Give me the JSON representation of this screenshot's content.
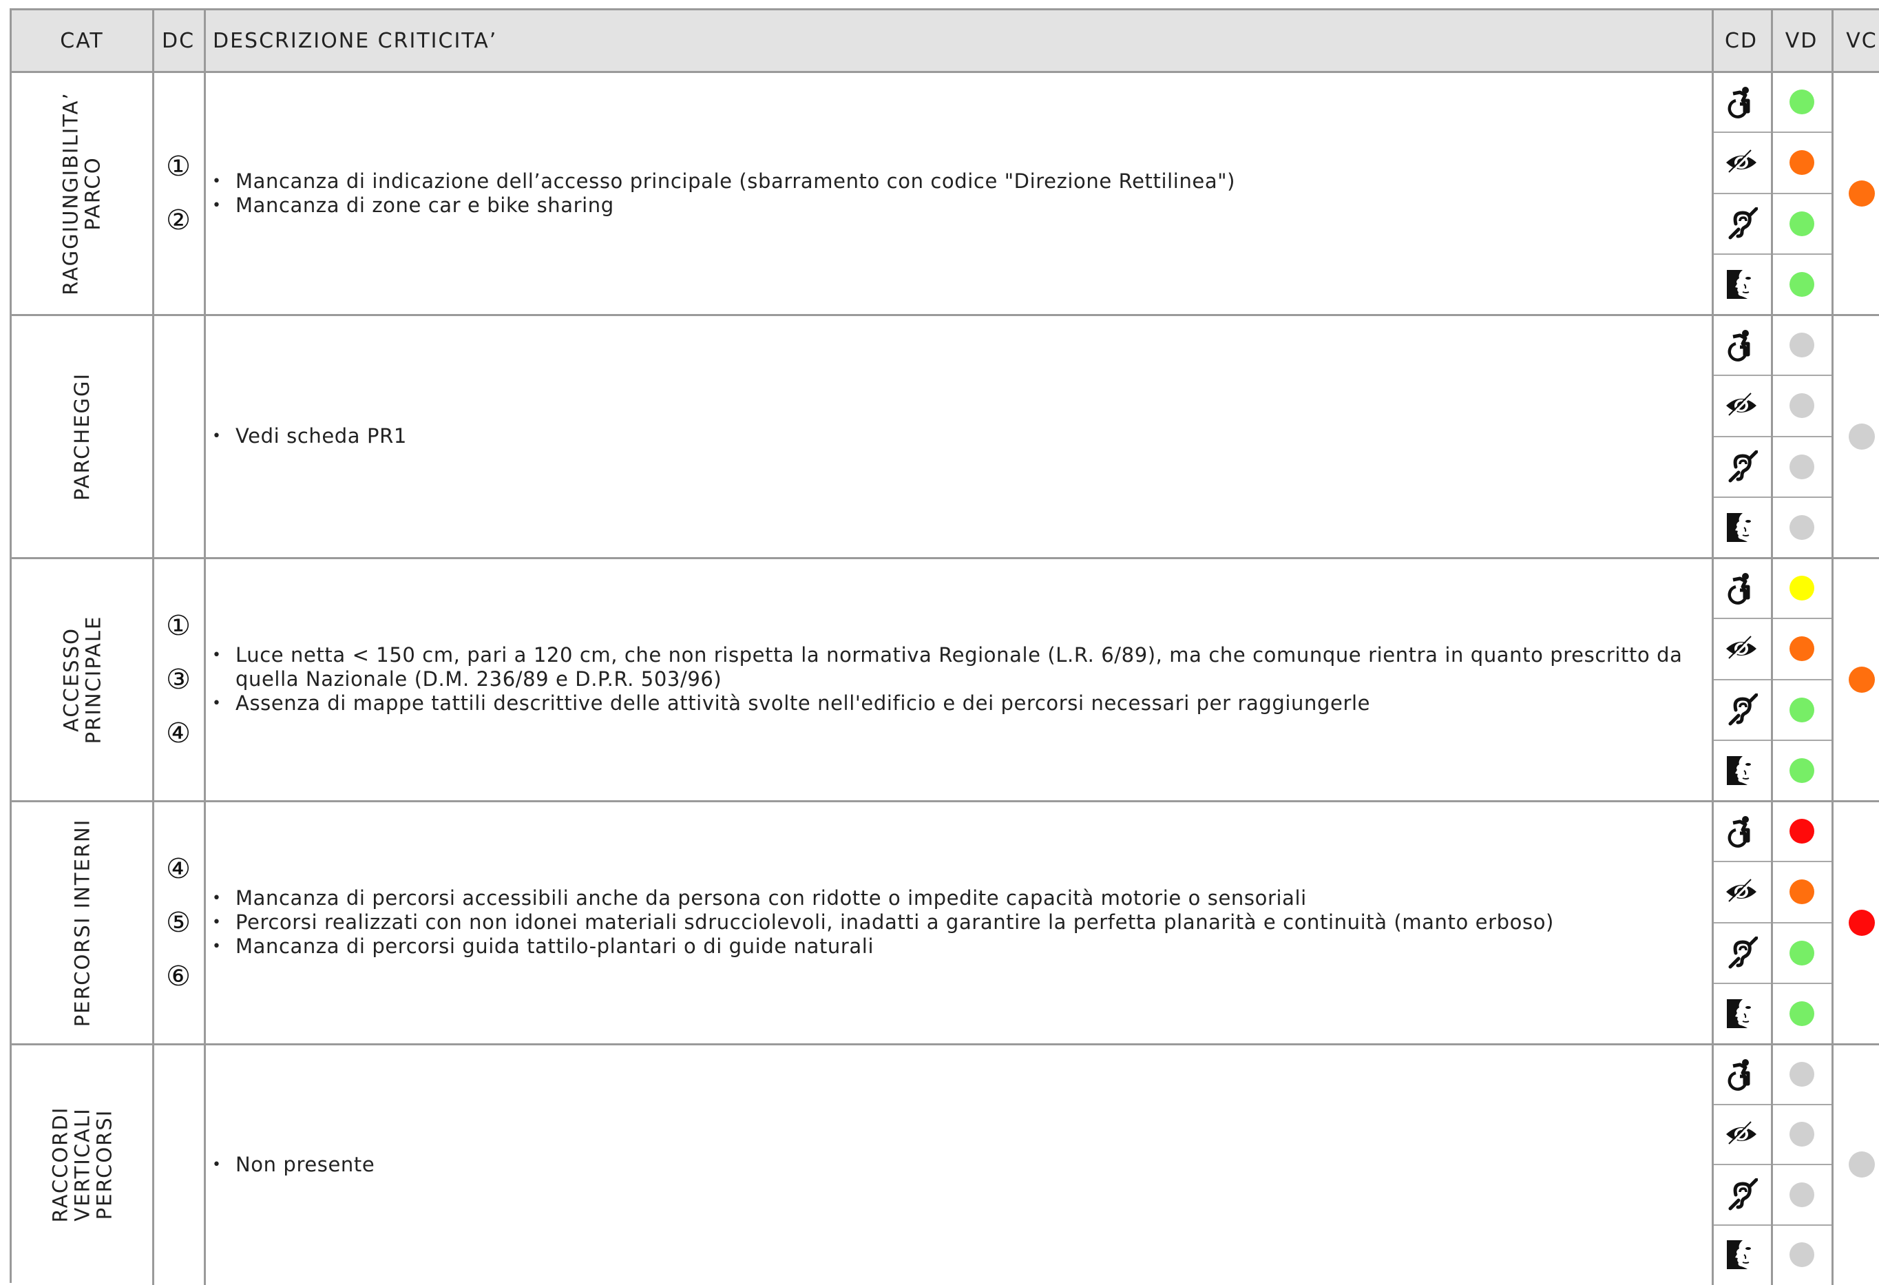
{
  "header": {
    "cat": "CAT",
    "dc": "DC",
    "desc": "DESCRIZIONE CRITICITA’",
    "cd": "CD",
    "vd": "VD",
    "vc": "VC"
  },
  "colors": {
    "green": "#77ee66",
    "orange": "#ff6f0e",
    "grey": "#d0d0d0",
    "yellow": "#ffff00",
    "red": "#ff0a0a",
    "grid": "#9a9a9a",
    "header_bg": "#e3e3e3"
  },
  "cd_icons": [
    "wheelchair-icon",
    "eye-icon",
    "hearing-icon",
    "face-icon"
  ],
  "rows": [
    {
      "category_lines": [
        "RAGGIUNGIBILITA’",
        "PARCO"
      ],
      "dc": [
        "①",
        "②"
      ],
      "items": [
        "Mancanza di indicazione dell’accesso principale (sbarramento con codice \"Direzione Rettilinea\")",
        "Mancanza di zone car e bike sharing"
      ],
      "vd": [
        "green",
        "orange",
        "green",
        "green"
      ],
      "vc": "orange"
    },
    {
      "category_lines": [
        "PARCHEGGI"
      ],
      "dc": [],
      "items": [
        "Vedi scheda PR1"
      ],
      "vd": [
        "grey",
        "grey",
        "grey",
        "grey"
      ],
      "vc": "grey"
    },
    {
      "category_lines": [
        "ACCESSO",
        "PRINCIPALE"
      ],
      "dc": [
        "①",
        "③",
        "④"
      ],
      "items": [
        "Luce netta < 150 cm, pari a 120 cm, che non rispetta la normativa Regionale (L.R. 6/89), ma che comunque rientra in quanto prescritto da quella Nazionale (D.M. 236/89 e D.P.R. 503/96)",
        "Assenza di mappe tattili descrittive delle attività svolte nell'edificio e dei percorsi necessari per raggiungerle"
      ],
      "vd": [
        "yellow",
        "orange",
        "green",
        "green"
      ],
      "vc": "orange"
    },
    {
      "category_lines": [
        "PERCORSI INTERNI"
      ],
      "dc": [
        "④",
        "⑤",
        "⑥"
      ],
      "items": [
        "Mancanza di percorsi accessibili anche da persona con ridotte o impedite capacità motorie o sensoriali",
        "Percorsi realizzati con non idonei materiali sdrucciolevoli, inadatti a garantire la perfetta planarità e continuità (manto erboso)",
        "Mancanza di percorsi guida tattilo-plantari o di guide naturali"
      ],
      "vd": [
        "red",
        "orange",
        "green",
        "green"
      ],
      "vc": "red"
    },
    {
      "category_lines": [
        "RACCORDI",
        "VERTICALI",
        "PERCORSI"
      ],
      "dc": [],
      "items": [
        "Non presente"
      ],
      "vd": [
        "grey",
        "grey",
        "grey",
        "grey"
      ],
      "vc": "grey"
    }
  ]
}
